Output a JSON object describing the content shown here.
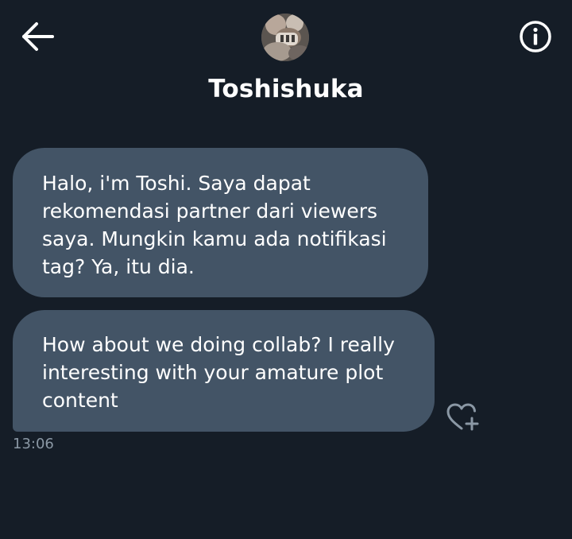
{
  "header": {
    "contact_name": "Toshishuka",
    "back_icon": "arrow-left-icon",
    "info_icon": "info-circle-icon",
    "avatar_icon": "profile-avatar"
  },
  "messages": [
    {
      "text": "Halo, i'm Toshi. Saya dapat rekomendasi partner dari viewers saya. Mungkin kamu ada notifikasi tag? Ya, itu dia."
    },
    {
      "text": "How about we doing collab? I really interesting with your amature plot content",
      "reaction_icon": "heart-plus-icon"
    }
  ],
  "timestamp": "13:06",
  "colors": {
    "background": "#151d27",
    "bubble": "#435466",
    "text": "#ffffff",
    "timestamp": "#8b98a5"
  }
}
